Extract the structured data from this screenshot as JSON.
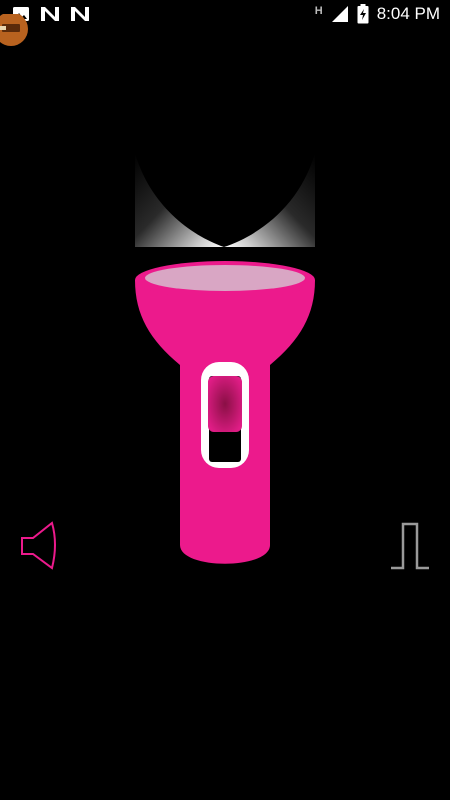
{
  "status_bar": {
    "time": "8:04 PM",
    "notification_icons": [
      "image-icon",
      "n-app-icon",
      "n-app-icon"
    ],
    "network_label": "H",
    "battery_state": "charging"
  },
  "flashlight": {
    "body_color": "#ec1a8c",
    "lens_color": "#d9a6c4",
    "switch_color": "#b3155f",
    "switch_on": false
  },
  "controls": {
    "sound_icon": "speaker-icon",
    "sound_color": "#ec1a8c",
    "strobe_icon": "square-wave-icon",
    "strobe_color": "#9a9a9a"
  }
}
